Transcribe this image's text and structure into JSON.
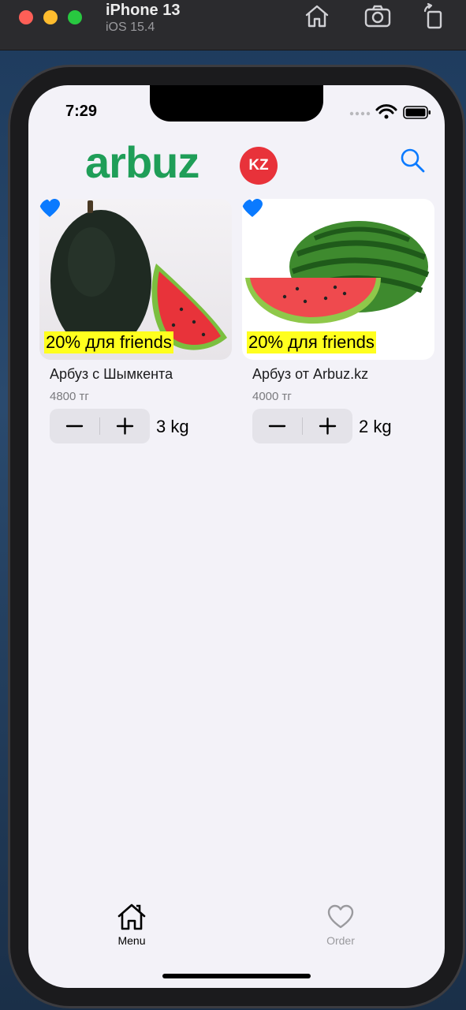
{
  "simulator": {
    "device_name": "iPhone 13",
    "os_version": "iOS 15.4",
    "icons": [
      "home-icon",
      "screenshot-icon",
      "rotate-icon"
    ]
  },
  "status_bar": {
    "time": "7:29",
    "icons": [
      "cellular-icon",
      "wifi-icon",
      "battery-icon"
    ]
  },
  "header": {
    "logo_text": "arbuz",
    "logo_badge": "KZ",
    "logo_text_color": "#1f9e58",
    "logo_badge_color": "#e8323a",
    "search_icon": "search-icon",
    "accent_color": "#0a7aff"
  },
  "products": [
    {
      "name": "Арбуз с Шымкента",
      "price": "4800 тг",
      "promo": "20% для friends",
      "quantity": "3 kg",
      "favorite": true,
      "image": "dark watermelon with slice"
    },
    {
      "name": "Арбуз от Arbuz.kz",
      "price": "4000 тг",
      "promo": "20% для friends",
      "quantity": "2 kg",
      "favorite": true,
      "image": "striped watermelon with slice"
    }
  ],
  "stepper_icons": [
    "minus-icon",
    "plus-icon"
  ],
  "promo_color": "#ffff1e",
  "tab_bar": {
    "tabs": [
      {
        "label": "Menu",
        "icon": "home-icon",
        "active": true
      },
      {
        "label": "Order",
        "icon": "heart-icon",
        "active": false
      }
    ]
  }
}
